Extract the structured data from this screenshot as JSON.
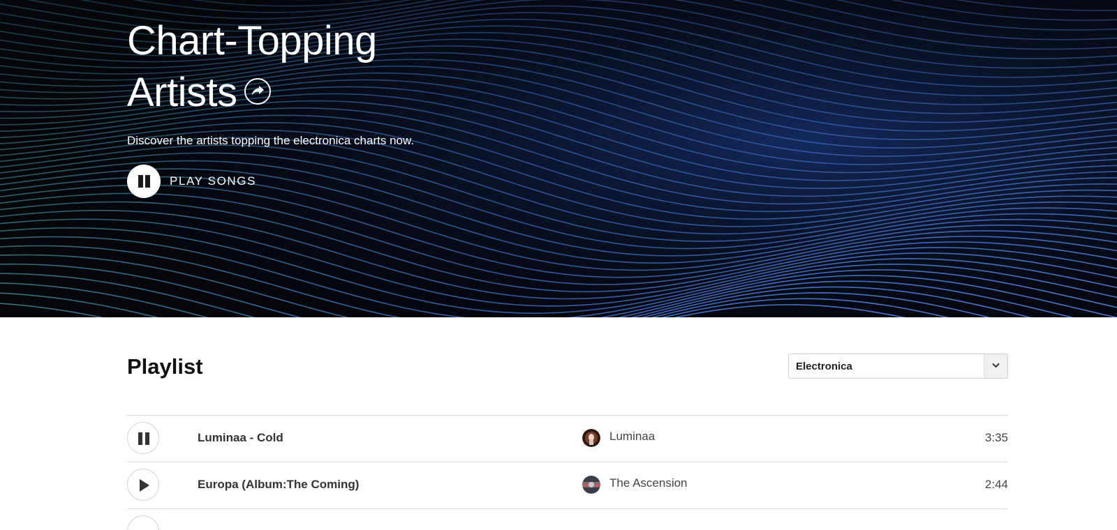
{
  "hero": {
    "title_line1": "Chart-Topping",
    "title_line2": "Artists",
    "description": "Discover the artists topping the electronica charts now.",
    "play_label": "PLAY SONGS",
    "share_icon": "share-arrow-icon",
    "play_icon": "pause-icon"
  },
  "playlist": {
    "heading": "Playlist",
    "genre_select": {
      "selected": "Electronica",
      "icon": "chevron-down-icon"
    },
    "tracks": [
      {
        "title": "Luminaa - Cold",
        "artist": "Luminaa",
        "duration": "3:35",
        "state_icon": "pause-icon"
      },
      {
        "title": "Europa (Album:The Coming)",
        "artist": "The Ascension",
        "duration": "2:44",
        "state_icon": "play-icon"
      }
    ]
  },
  "colors": {
    "hero_background": "#05070d",
    "wave_blue": "#4f7fe0",
    "wave_teal": "#5fb8b0",
    "divider": "#d9d9d9"
  }
}
